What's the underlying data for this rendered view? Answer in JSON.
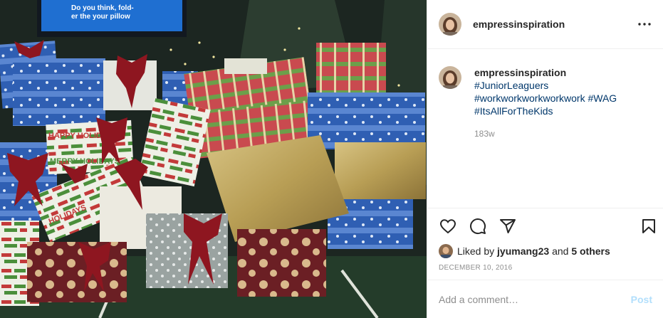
{
  "photo": {
    "alt": "",
    "tv_text_line1": "Do you think, fold-",
    "tv_text_line2": "er the your pillow",
    "wrapping_text_1": "HAPPY HOLIDAYS",
    "wrapping_text_2": "MERRY HOLIDAYS",
    "wrapping_text_3": "HOLIDAYS"
  },
  "post": {
    "username": "empressinspiration",
    "caption_username": "empressinspiration",
    "hashtags": [
      "#JuniorLeaguers",
      "#workworkworkworkwork",
      "#WAG",
      "#ItsAllForTheKids"
    ],
    "age": "183w",
    "liked_by_prefix": "Liked by",
    "liked_by_user": "jyumang23",
    "liked_by_and": "and",
    "liked_by_others": "5 others",
    "date": "DECEMBER 10, 2016"
  },
  "comment": {
    "placeholder": "Add a comment…",
    "post_label": "Post"
  },
  "icons": {
    "like": "heart-icon",
    "comment": "comment-icon",
    "share": "paper-plane-icon",
    "save": "bookmark-icon",
    "more": "more-options-icon"
  },
  "colors": {
    "hashtag": "#00376b",
    "muted": "#8e8e8e",
    "post_disabled": "#b2dffc"
  }
}
